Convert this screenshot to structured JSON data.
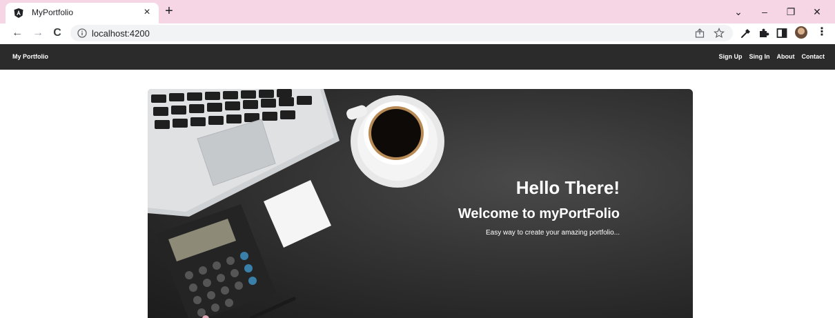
{
  "browser": {
    "tab": {
      "title": "MyPortfolio",
      "favicon": "angular-icon",
      "close": "×"
    },
    "new_tab": "+",
    "window_controls": {
      "dropdown": "⌄",
      "minimize": "–",
      "restore": "❐",
      "close": "✕"
    },
    "nav": {
      "back": "←",
      "forward": "→",
      "reload": "C"
    },
    "url": "localhost:4200",
    "accent": "#f6d6e5"
  },
  "navbar": {
    "brand": "My Portfolio",
    "links": [
      "Sign Up",
      "Sing In",
      "About",
      "Contact"
    ],
    "background": "#2b2b2b"
  },
  "hero": {
    "title": "Hello There!",
    "subtitle": "Welcome to myPortFolio",
    "tagline": "Easy way to create your amazing portfolio..."
  }
}
